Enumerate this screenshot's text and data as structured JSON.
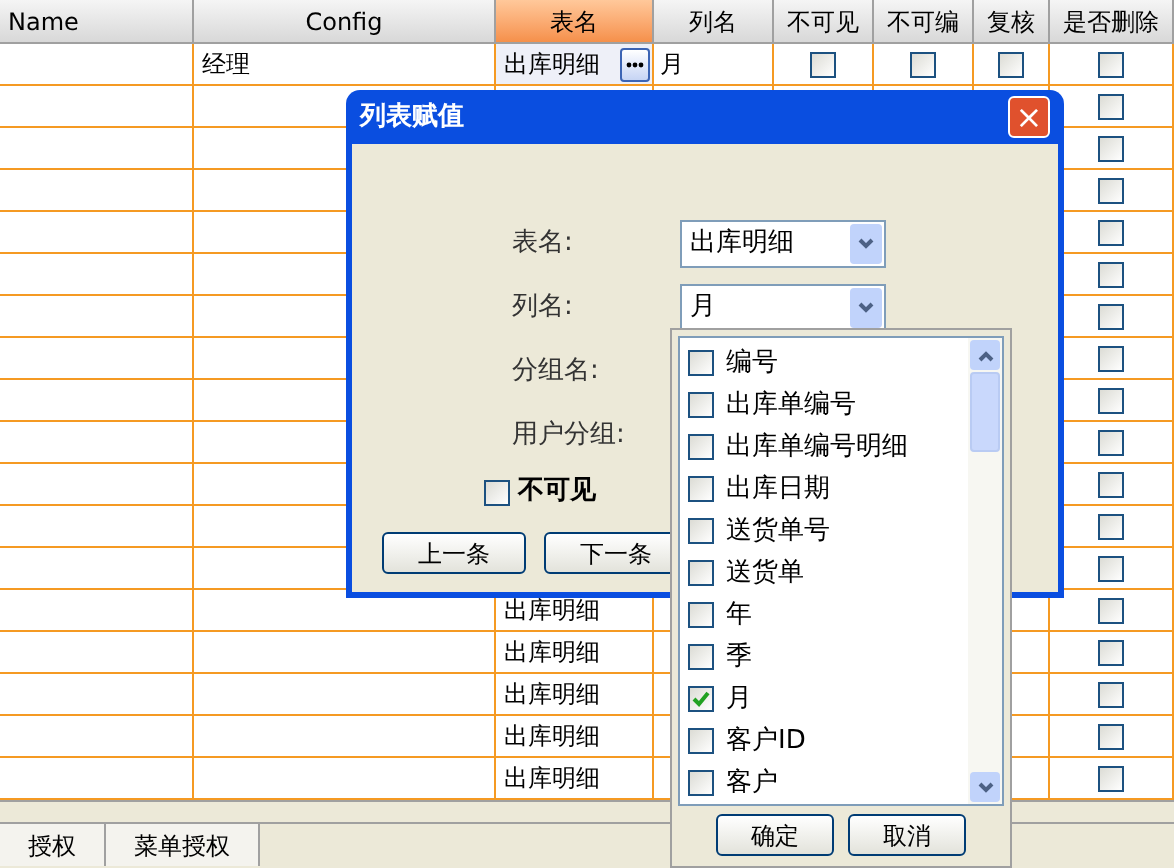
{
  "grid": {
    "columns": [
      {
        "label": "Name",
        "selected": false
      },
      {
        "label": "Config",
        "selected": false
      },
      {
        "label": "表名",
        "selected": true
      },
      {
        "label": "列名",
        "selected": false
      },
      {
        "label": "不可见",
        "selected": false
      },
      {
        "label": "不可编",
        "selected": false
      },
      {
        "label": "复核",
        "selected": false
      },
      {
        "label": "是否删除",
        "selected": false
      }
    ],
    "rows": [
      {
        "config": "经理",
        "table": "出库明细",
        "editing": true,
        "column": "月",
        "invisible": false,
        "readonly": false,
        "review": false,
        "delete": false
      },
      {
        "delete": false
      },
      {
        "delete": false
      },
      {
        "delete": false
      },
      {
        "delete": false
      },
      {
        "delete": false
      },
      {
        "delete": false
      },
      {
        "delete": false
      },
      {
        "delete": false
      },
      {
        "delete": false
      },
      {
        "delete": false
      },
      {
        "delete": false
      },
      {
        "delete": false
      },
      {
        "table": "出库明细",
        "delete": false
      },
      {
        "table": "出库明细",
        "delete": false
      },
      {
        "table": "出库明细",
        "delete": false
      },
      {
        "table": "出库明细",
        "delete": false
      },
      {
        "table": "出库明细",
        "delete": false
      }
    ]
  },
  "dialog": {
    "title": "列表赋值",
    "close": "×",
    "fields": [
      {
        "kind": "combo",
        "label": "表名:",
        "value": "出库明细"
      },
      {
        "kind": "combo",
        "label": "列名:",
        "value": "月"
      },
      {
        "kind": "label",
        "label": "分组名:"
      },
      {
        "kind": "label",
        "label": "用户分组:"
      }
    ],
    "checkbox": {
      "label": "不可见",
      "checked": false
    },
    "buttons": [
      "上一条",
      "下一条"
    ]
  },
  "dropdown": {
    "items": [
      {
        "label": "编号",
        "checked": false
      },
      {
        "label": "出库单编号",
        "checked": false
      },
      {
        "label": "出库单编号明细",
        "checked": false
      },
      {
        "label": "出库日期",
        "checked": false
      },
      {
        "label": "送货单号",
        "checked": false
      },
      {
        "label": "送货单",
        "checked": false
      },
      {
        "label": "年",
        "checked": false
      },
      {
        "label": "季",
        "checked": false
      },
      {
        "label": "月",
        "checked": true
      },
      {
        "label": "客户ID",
        "checked": false
      },
      {
        "label": "客户",
        "checked": false
      }
    ],
    "buttons": [
      "确定",
      "取消"
    ]
  },
  "tabs": [
    {
      "label": "授权",
      "selected": false
    },
    {
      "label": "菜单授权",
      "selected": false
    }
  ]
}
